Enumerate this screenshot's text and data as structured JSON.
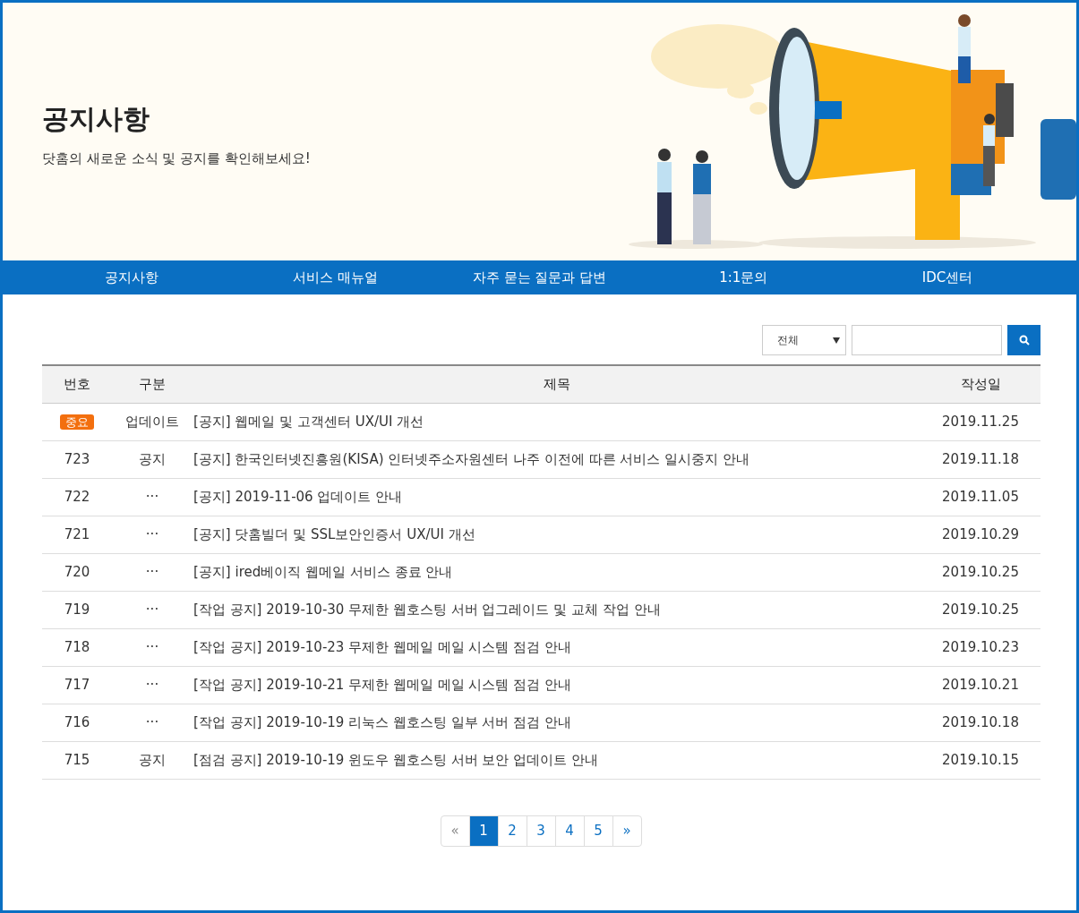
{
  "hero": {
    "title": "공지사항",
    "subtitle": "닷홈의 새로운 소식 및 공지를 확인해보세요!"
  },
  "nav": [
    "공지사항",
    "서비스 매뉴얼",
    "자주 묻는 질문과 답변",
    "1:1문의",
    "IDC센터"
  ],
  "search": {
    "filter": "전체"
  },
  "table": {
    "columns": [
      "번호",
      "구분",
      "제목",
      "작성일"
    ],
    "rows": [
      {
        "kind": "notice",
        "number": "중요",
        "category": "업데이트",
        "title": "[공지] 웹메일 및 고객센터 UX/UI 개선",
        "date": "2019.11.25"
      },
      {
        "kind": "post",
        "number": "723",
        "category": "공지",
        "title": "[공지] 한국인터넷진흥원(KISA) 인터넷주소자원센터 나주 이전에 따른 서비스 일시중지 안내",
        "date": "2019.11.18"
      },
      {
        "kind": "post",
        "number": "722",
        "category": "···",
        "title": "[공지] 2019-11-06 업데이트 안내",
        "date": "2019.11.05"
      },
      {
        "kind": "post",
        "number": "721",
        "category": "···",
        "title": "[공지] 닷홈빌더 및 SSL보안인증서 UX/UI 개선",
        "date": "2019.10.29"
      },
      {
        "kind": "post",
        "number": "720",
        "category": "···",
        "title": "[공지] ired베이직 웹메일 서비스 종료 안내",
        "date": "2019.10.25"
      },
      {
        "kind": "post",
        "number": "719",
        "category": "···",
        "title": "[작업 공지] 2019-10-30 무제한 웹호스팅 서버 업그레이드 및 교체 작업 안내",
        "date": "2019.10.25"
      },
      {
        "kind": "post",
        "number": "718",
        "category": "···",
        "title": "[작업 공지] 2019-10-23 무제한 웹메일 메일 시스템 점검 안내",
        "date": "2019.10.23"
      },
      {
        "kind": "post",
        "number": "717",
        "category": "···",
        "title": "[작업 공지] 2019-10-21 무제한 웹메일 메일 시스템 점검 안내",
        "date": "2019.10.21"
      },
      {
        "kind": "post",
        "number": "716",
        "category": "···",
        "title": "[작업 공지] 2019-10-19 리눅스 웹호스팅 일부 서버 점검 안내",
        "date": "2019.10.18"
      },
      {
        "kind": "post",
        "number": "715",
        "category": "공지",
        "title": "[점검 공지] 2019-10-19 윈도우 웹호스팅 서버 보안 업데이트 안내",
        "date": "2019.10.15"
      }
    ]
  },
  "pagination": [
    {
      "label": "«",
      "selected": false,
      "disabled": true
    },
    {
      "label": "1",
      "selected": true,
      "disabled": false
    },
    {
      "label": "2",
      "selected": false,
      "disabled": false
    },
    {
      "label": "3",
      "selected": false,
      "disabled": false
    },
    {
      "label": "4",
      "selected": false,
      "disabled": false
    },
    {
      "label": "5",
      "selected": false,
      "disabled": false
    },
    {
      "label": "»",
      "selected": false,
      "disabled": false
    }
  ]
}
